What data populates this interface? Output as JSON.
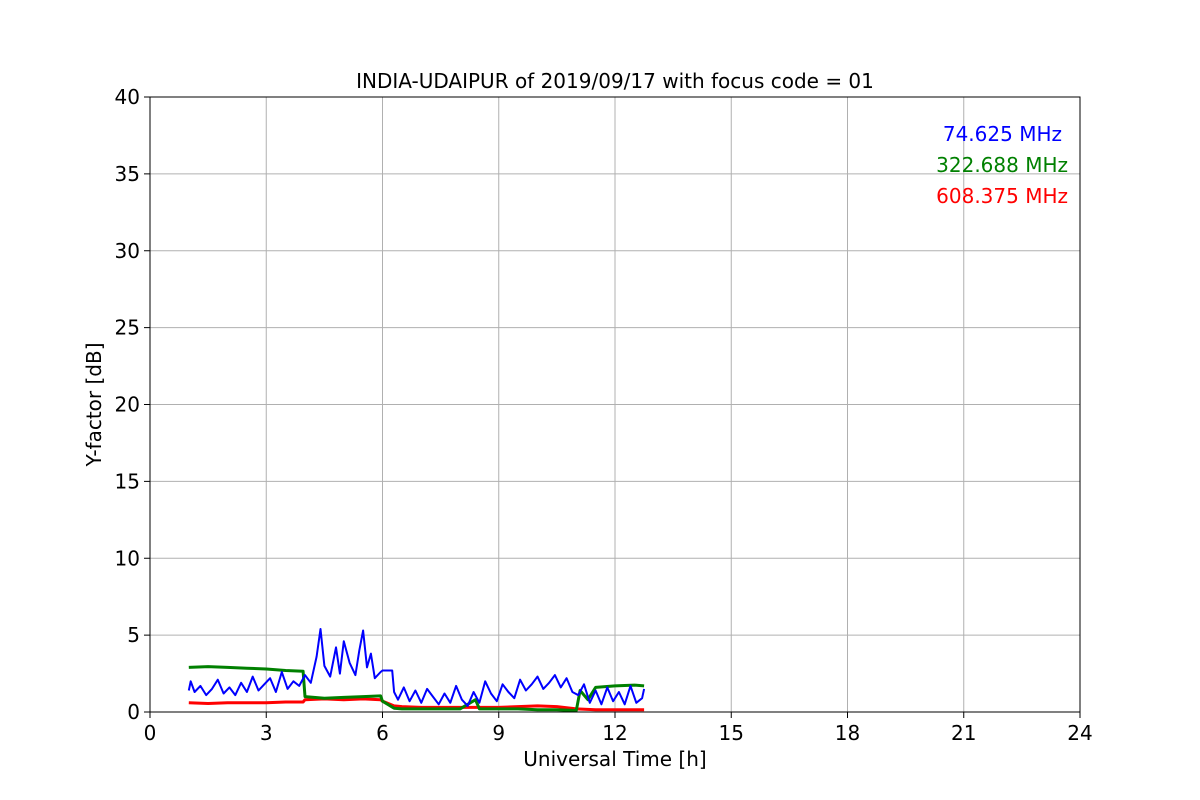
{
  "chart_data": {
    "type": "line",
    "title": "INDIA-UDAIPUR of 2019/09/17 with focus code = 01",
    "xlabel": "Universal Time [h]",
    "ylabel": "Y-factor [dB]",
    "xlim": [
      0,
      24
    ],
    "ylim": [
      0,
      40
    ],
    "xticks": [
      0,
      3,
      6,
      9,
      12,
      15,
      18,
      21,
      24
    ],
    "yticks": [
      0,
      5,
      10,
      15,
      20,
      25,
      30,
      35,
      40
    ],
    "grid": true,
    "legend": "top-right",
    "series": [
      {
        "name": "74.625 MHz",
        "color": "#0000ff",
        "x": [
          1.0,
          1.05,
          1.15,
          1.3,
          1.45,
          1.6,
          1.75,
          1.9,
          2.05,
          2.2,
          2.35,
          2.5,
          2.65,
          2.8,
          2.95,
          3.1,
          3.25,
          3.4,
          3.55,
          3.7,
          3.85,
          4.0,
          4.15,
          4.3,
          4.4,
          4.5,
          4.65,
          4.8,
          4.9,
          5.0,
          5.15,
          5.3,
          5.4,
          5.5,
          5.6,
          5.7,
          5.8,
          5.95,
          6.0,
          6.25,
          6.3,
          6.4,
          6.55,
          6.7,
          6.85,
          7.0,
          7.15,
          7.3,
          7.45,
          7.6,
          7.75,
          7.9,
          8.05,
          8.2,
          8.35,
          8.5,
          8.65,
          8.8,
          8.95,
          9.1,
          9.25,
          9.4,
          9.55,
          9.7,
          9.85,
          10.0,
          10.15,
          10.3,
          10.45,
          10.6,
          10.75,
          10.9,
          11.05,
          11.2,
          11.35,
          11.5,
          11.65,
          11.8,
          11.95,
          12.1,
          12.25,
          12.4,
          12.55,
          12.7,
          12.75
        ],
        "values": [
          1.4,
          2.0,
          1.3,
          1.7,
          1.1,
          1.5,
          2.1,
          1.2,
          1.6,
          1.1,
          1.9,
          1.3,
          2.3,
          1.4,
          1.8,
          2.2,
          1.3,
          2.6,
          1.5,
          2.0,
          1.7,
          2.4,
          1.9,
          3.6,
          5.4,
          3.0,
          2.3,
          4.2,
          2.5,
          4.6,
          3.2,
          2.4,
          4.0,
          5.3,
          2.9,
          3.8,
          2.2,
          2.6,
          2.7,
          2.7,
          1.3,
          0.8,
          1.6,
          0.7,
          1.4,
          0.6,
          1.5,
          1.0,
          0.5,
          1.2,
          0.6,
          1.7,
          0.8,
          0.4,
          1.3,
          0.6,
          2.0,
          1.2,
          0.7,
          1.8,
          1.3,
          0.9,
          2.1,
          1.4,
          1.8,
          2.3,
          1.5,
          1.9,
          2.4,
          1.6,
          2.2,
          1.3,
          1.1,
          1.8,
          0.6,
          1.4,
          0.5,
          1.6,
          0.7,
          1.3,
          0.5,
          1.7,
          0.6,
          0.9,
          1.5
        ]
      },
      {
        "name": "322.688 MHz",
        "color": "#008000",
        "x": [
          1.0,
          1.5,
          2.0,
          2.5,
          3.0,
          3.5,
          3.95,
          4.0,
          4.5,
          5.0,
          5.5,
          5.95,
          6.0,
          6.3,
          6.5,
          7.0,
          7.5,
          8.0,
          8.4,
          8.5,
          9.0,
          9.5,
          10.0,
          10.5,
          11.0,
          11.1,
          11.3,
          11.5,
          12.0,
          12.5,
          12.75
        ],
        "values": [
          2.9,
          2.95,
          2.9,
          2.85,
          2.8,
          2.7,
          2.65,
          1.0,
          0.9,
          0.95,
          1.0,
          1.05,
          0.7,
          0.25,
          0.2,
          0.2,
          0.2,
          0.2,
          0.8,
          0.2,
          0.2,
          0.2,
          0.15,
          0.15,
          0.1,
          1.4,
          0.8,
          1.6,
          1.7,
          1.75,
          1.7
        ]
      },
      {
        "name": "608.375 MHz",
        "color": "#ff0000",
        "x": [
          1.0,
          1.5,
          2.0,
          2.5,
          3.0,
          3.5,
          3.95,
          4.0,
          4.5,
          5.0,
          5.5,
          5.95,
          6.0,
          6.3,
          6.5,
          7.0,
          7.5,
          8.0,
          8.5,
          9.0,
          9.5,
          10.0,
          10.5,
          11.0,
          11.5,
          12.0,
          12.5,
          12.75
        ],
        "values": [
          0.6,
          0.55,
          0.6,
          0.6,
          0.6,
          0.65,
          0.65,
          0.8,
          0.85,
          0.8,
          0.85,
          0.8,
          0.7,
          0.4,
          0.35,
          0.3,
          0.3,
          0.3,
          0.3,
          0.3,
          0.35,
          0.4,
          0.35,
          0.2,
          0.15,
          0.15,
          0.15,
          0.15
        ]
      }
    ]
  }
}
